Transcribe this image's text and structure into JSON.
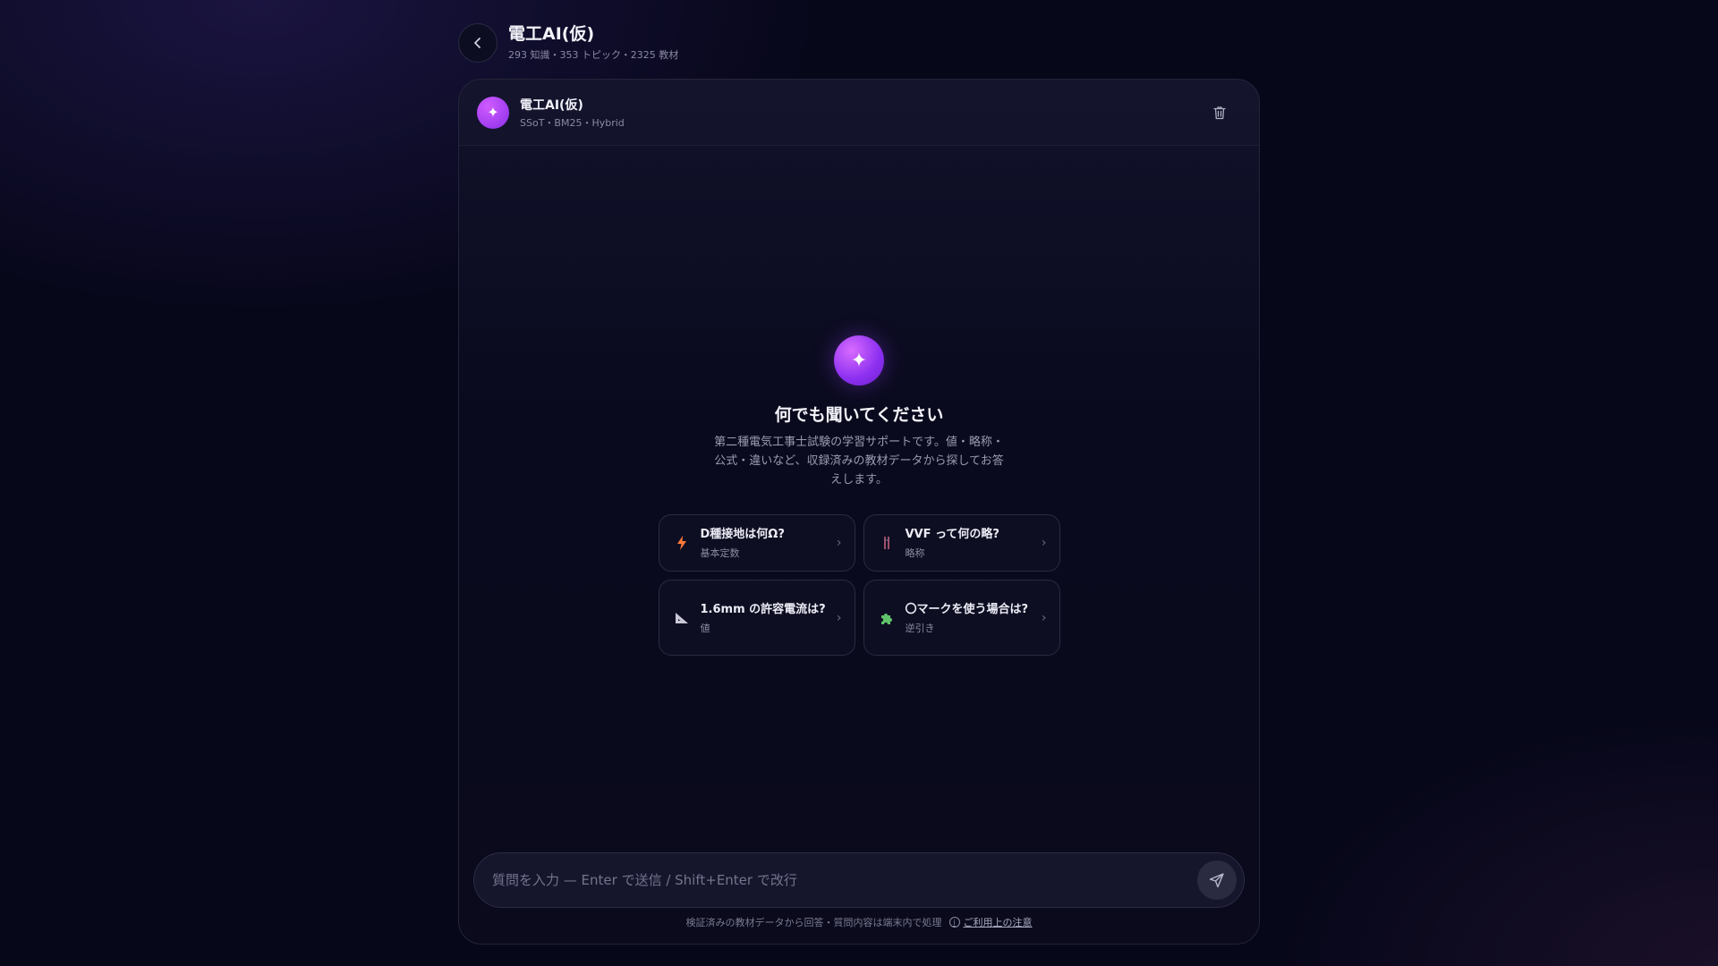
{
  "header": {
    "title": "電工AI(仮)",
    "subtitle": "293 知識・353 トピック・2325 教材"
  },
  "bot": {
    "name": "電工AI(仮)",
    "meta": "SSoT・BM25・Hybrid"
  },
  "empty_state": {
    "title": "何でも聞いてください",
    "description": "第二種電気工事士試験の学習サポートです。値・略称・公式・違いなど、収録済みの教材データから探してお答えします。"
  },
  "suggestions": [
    {
      "icon": "lightning-icon",
      "title": "D種接地は何Ω?",
      "category": "基本定数"
    },
    {
      "icon": "wire-icon",
      "title": "VVF って何の略?",
      "category": "略称"
    },
    {
      "icon": "triangle-ruler-icon",
      "title": "1.6mm の許容電流は?",
      "category": "値"
    },
    {
      "icon": "puzzle-icon",
      "title": "〇マークを使う場合は?",
      "category": "逆引き"
    }
  ],
  "composer": {
    "placeholder": "質問を入力 — Enter で送信 / Shift+Enter で改行"
  },
  "footer": {
    "note": "検証済みの教材データから回答・質問内容は端末内で処理",
    "notice_link": "ご利用上の注意"
  },
  "colors": {
    "accent": "#a63df5",
    "background": "#07071a"
  }
}
